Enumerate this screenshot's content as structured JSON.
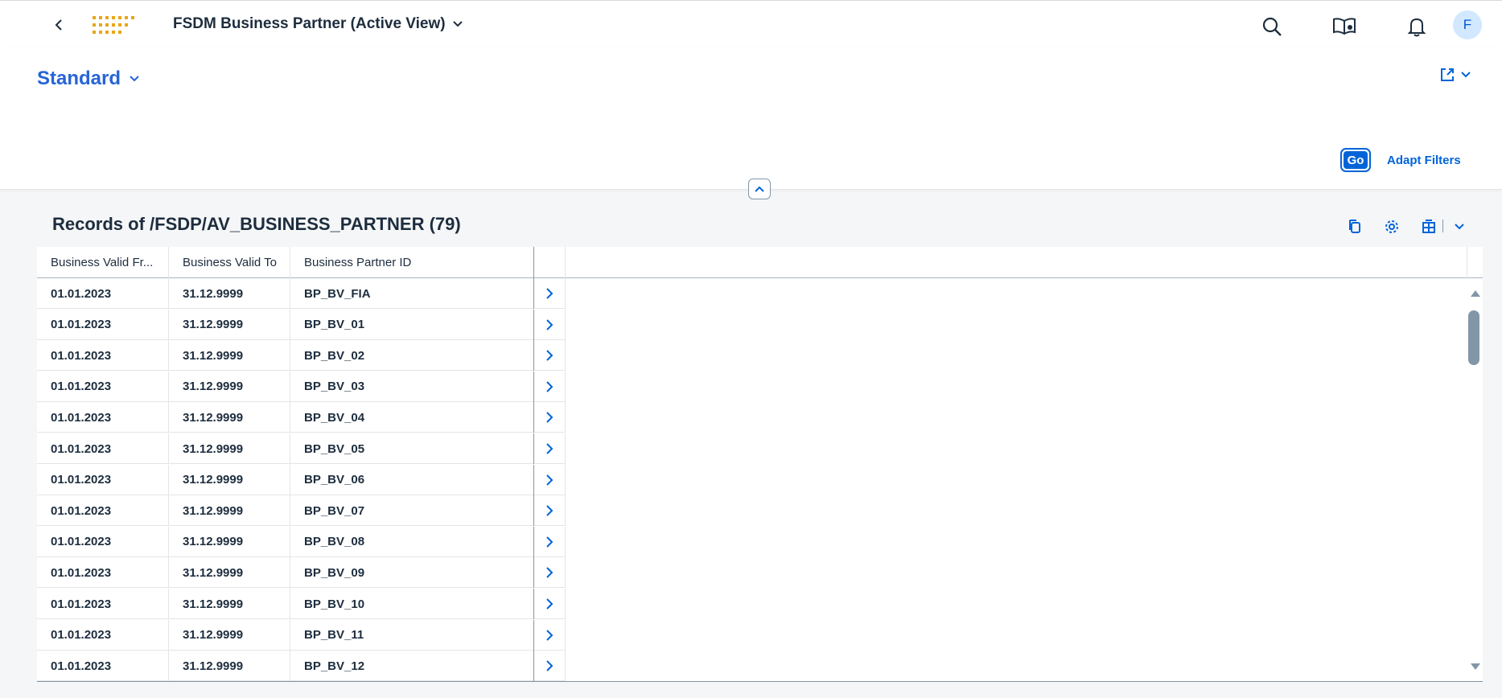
{
  "shell": {
    "title": "FSDM Business Partner (Active View)",
    "avatar_initial": "F",
    "icons": [
      "back-icon",
      "company-logo",
      "search-icon",
      "joule-icon",
      "notification-bell-icon"
    ]
  },
  "header": {
    "variant": "Standard",
    "go_label": "Go",
    "adapt_filters_label": "Adapt Filters"
  },
  "table": {
    "title": "Records of /FSDP/AV_BUSINESS_PARTNER (79)",
    "columns": [
      "Business Valid Fr...",
      "Business Valid To",
      "Business Partner ID"
    ],
    "rows": [
      [
        "01.01.2023",
        "31.12.9999",
        "BP_BV_FIA"
      ],
      [
        "01.01.2023",
        "31.12.9999",
        "BP_BV_01"
      ],
      [
        "01.01.2023",
        "31.12.9999",
        "BP_BV_02"
      ],
      [
        "01.01.2023",
        "31.12.9999",
        "BP_BV_03"
      ],
      [
        "01.01.2023",
        "31.12.9999",
        "BP_BV_04"
      ],
      [
        "01.01.2023",
        "31.12.9999",
        "BP_BV_05"
      ],
      [
        "01.01.2023",
        "31.12.9999",
        "BP_BV_06"
      ],
      [
        "01.01.2023",
        "31.12.9999",
        "BP_BV_07"
      ],
      [
        "01.01.2023",
        "31.12.9999",
        "BP_BV_08"
      ],
      [
        "01.01.2023",
        "31.12.9999",
        "BP_BV_09"
      ],
      [
        "01.01.2023",
        "31.12.9999",
        "BP_BV_10"
      ],
      [
        "01.01.2023",
        "31.12.9999",
        "BP_BV_11"
      ],
      [
        "01.01.2023",
        "31.12.9999",
        "BP_BV_12"
      ]
    ]
  },
  "colors": {
    "brand_blue": "#0064d9",
    "text": "#1d2d3e",
    "logo_gold": "#e8a619",
    "background": "#f5f6f7"
  }
}
